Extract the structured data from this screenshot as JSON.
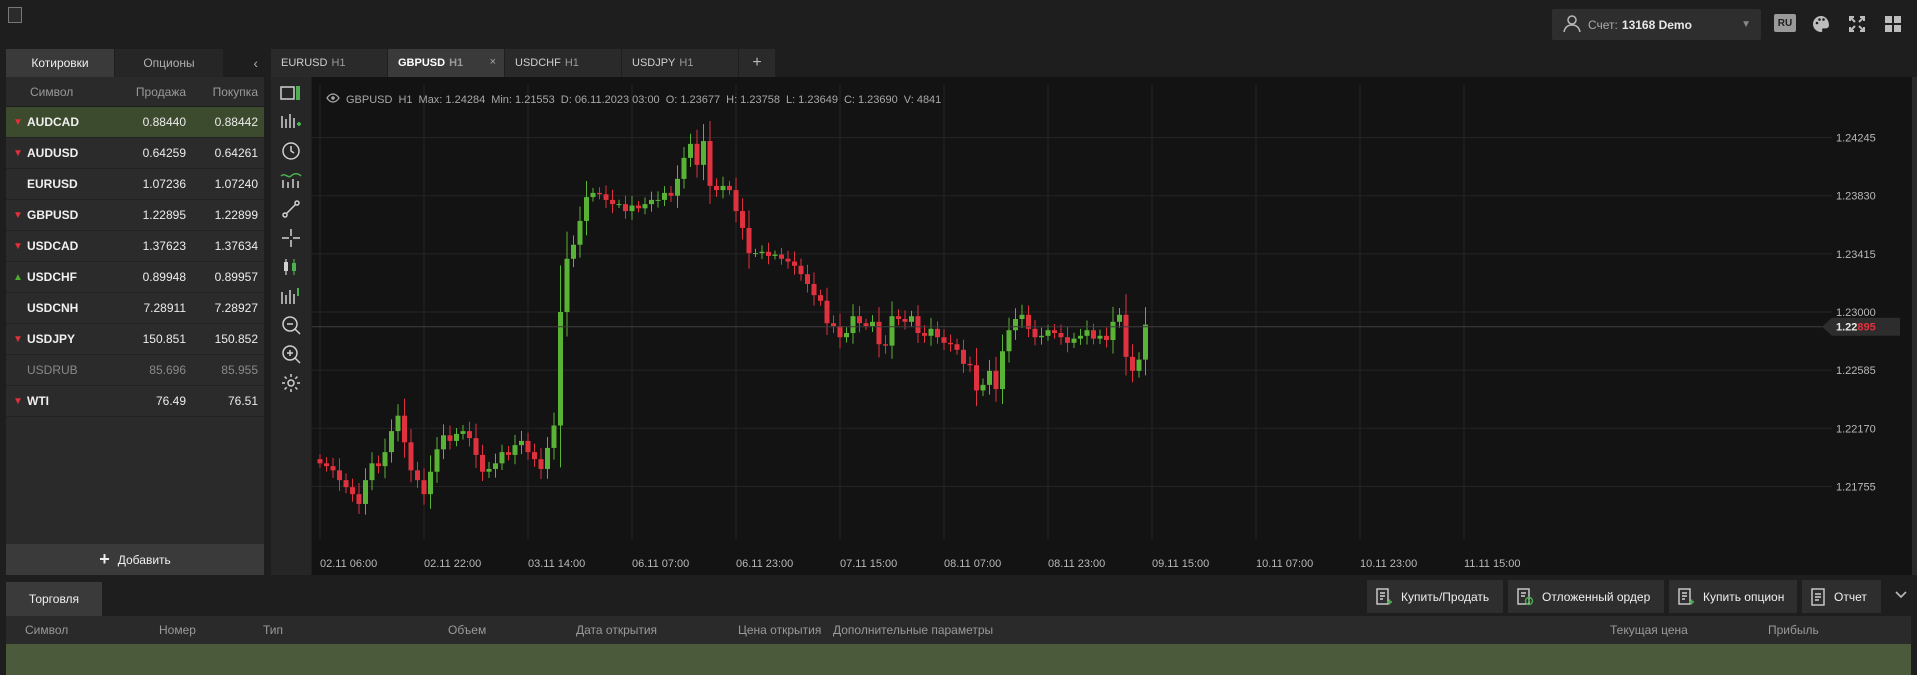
{
  "topbar": {
    "account_label": "Счет:",
    "account_value": "13168 Demo",
    "lang": "RU"
  },
  "quotes_panel": {
    "tabs": [
      "Котировки",
      "Опционы"
    ],
    "columns": {
      "symbol": "Символ",
      "sell": "Продажа",
      "buy": "Покупка"
    },
    "rows": [
      {
        "symbol": "AUDCAD",
        "sell": "0.88440",
        "buy": "0.88442",
        "trend": "down",
        "selected": true
      },
      {
        "symbol": "AUDUSD",
        "sell": "0.64259",
        "buy": "0.64261",
        "trend": "down"
      },
      {
        "symbol": "EURUSD",
        "sell": "1.07236",
        "buy": "1.07240",
        "trend": "none"
      },
      {
        "symbol": "GBPUSD",
        "sell": "1.22895",
        "buy": "1.22899",
        "trend": "down"
      },
      {
        "symbol": "USDCAD",
        "sell": "1.37623",
        "buy": "1.37634",
        "trend": "down"
      },
      {
        "symbol": "USDCHF",
        "sell": "0.89948",
        "buy": "0.89957",
        "trend": "up"
      },
      {
        "symbol": "USDCNH",
        "sell": "7.28911",
        "buy": "7.28927",
        "trend": "none"
      },
      {
        "symbol": "USDJPY",
        "sell": "150.851",
        "buy": "150.852",
        "trend": "down"
      },
      {
        "symbol": "USDRUB",
        "sell": "85.696",
        "buy": "85.955",
        "trend": "none",
        "disabled": true
      },
      {
        "symbol": "WTI",
        "sell": "76.49",
        "buy": "76.51",
        "trend": "down"
      }
    ],
    "add_label": "Добавить"
  },
  "chart_tabs": [
    {
      "symbol": "EURUSD",
      "tf": "H1"
    },
    {
      "symbol": "GBPUSD",
      "tf": "H1",
      "active": true,
      "close": "×"
    },
    {
      "symbol": "USDCHF",
      "tf": "H1"
    },
    {
      "symbol": "USDJPY",
      "tf": "H1"
    }
  ],
  "tab_add": "+",
  "toolbar_icons": [
    "chart-type-icon",
    "indicators-icon",
    "timeframe-clock-icon",
    "indicator-wave-icon",
    "trendline-icon",
    "crosshair-icon",
    "candles-icon",
    "volume-icon",
    "zoom-out-icon",
    "zoom-in-icon",
    "settings-gear-icon"
  ],
  "chart_info": {
    "symbol": "GBPUSD",
    "tf": "H1",
    "max": "Max: 1.24284",
    "min": "Min: 1.21553",
    "date": "D: 06.11.2023 03:00",
    "open": "O: 1.23677",
    "high": "H: 1.23758",
    "low": "L: 1.23649",
    "close": "C: 1.23690",
    "volume": "V: 4841"
  },
  "chart_data": {
    "type": "candlestick",
    "symbol": "GBPUSD",
    "timeframe": "H1",
    "y_ticks": [
      "1.24245",
      "1.23830",
      "1.23415",
      "1.23000",
      "1.22585",
      "1.22170",
      "1.21755"
    ],
    "ylim": [
      1.2138,
      1.2462
    ],
    "x_ticks": [
      "02.11 06:00",
      "02.11 22:00",
      "03.11 14:00",
      "06.11 07:00",
      "06.11 23:00",
      "07.11 15:00",
      "08.11 07:00",
      "08.11 23:00",
      "09.11 15:00",
      "10.11 07:00",
      "10.11 23:00",
      "11.11 15:00"
    ],
    "x_tick_bar_index": [
      0,
      16,
      32,
      48,
      64,
      80,
      96,
      112,
      128,
      144,
      160,
      176
    ],
    "current_price": {
      "prefix": "1.22",
      "suffix": "895",
      "value": 1.22895
    },
    "closes": [
      1.2192,
      1.219,
      1.2187,
      1.218,
      1.2175,
      1.217,
      1.2163,
      1.218,
      1.2192,
      1.219,
      1.22,
      1.2215,
      1.2226,
      1.2207,
      1.2187,
      1.218,
      1.217,
      1.2186,
      1.2202,
      1.2212,
      1.2208,
      1.2213,
      1.2215,
      1.221,
      1.2198,
      1.2186,
      1.2188,
      1.2192,
      1.22,
      1.2198,
      1.2205,
      1.2208,
      1.22,
      1.2195,
      1.2188,
      1.2203,
      1.2219,
      1.23,
      1.2338,
      1.2348,
      1.2365,
      1.2382,
      1.2385,
      1.2384,
      1.238,
      1.2377,
      1.2377,
      1.2372,
      1.2376,
      1.2374,
      1.2377,
      1.238,
      1.238,
      1.2385,
      1.2383,
      1.2395,
      1.241,
      1.242,
      1.2405,
      1.2422,
      1.239,
      1.2387,
      1.239,
      1.2387,
      1.2372,
      1.236,
      1.2342,
      1.2342,
      1.2343,
      1.234,
      1.2341,
      1.2338,
      1.2336,
      1.2333,
      1.2327,
      1.232,
      1.2312,
      1.2308,
      1.2292,
      1.229,
      1.2282,
      1.2285,
      1.2297,
      1.2292,
      1.229,
      1.2293,
      1.2277,
      1.2276,
      1.2297,
      1.2295,
      1.2293,
      1.2297,
      1.2285,
      1.2283,
      1.2288,
      1.2282,
      1.2278,
      1.2277,
      1.2273,
      1.2263,
      1.2262,
      1.2244,
      1.2248,
      1.2258,
      1.2245,
      1.2272,
      1.2287,
      1.2295,
      1.2298,
      1.2288,
      1.2282,
      1.2283,
      1.2287,
      1.2285,
      1.2282,
      1.2278,
      1.2281,
      1.2283,
      1.2287,
      1.2281,
      1.2283,
      1.228,
      1.2293,
      1.2298,
      1.2268,
      1.2258,
      1.2266,
      1.2291
    ]
  },
  "bottom": {
    "tab": "Торговля",
    "buttons": [
      "Купить/Продать",
      "Отложенный ордер",
      "Купить опцион",
      "Отчет"
    ],
    "columns": [
      "Символ",
      "Номер",
      "Тип",
      "Объем",
      "Дата открытия",
      "Цена открытия",
      "Дополнительные параметры",
      "Текущая цена",
      "Прибыль"
    ]
  },
  "colors": {
    "bull": "#59b336",
    "bear": "#e0313f",
    "accent": "#4caf50",
    "selected_row": "#3c4a2e"
  }
}
